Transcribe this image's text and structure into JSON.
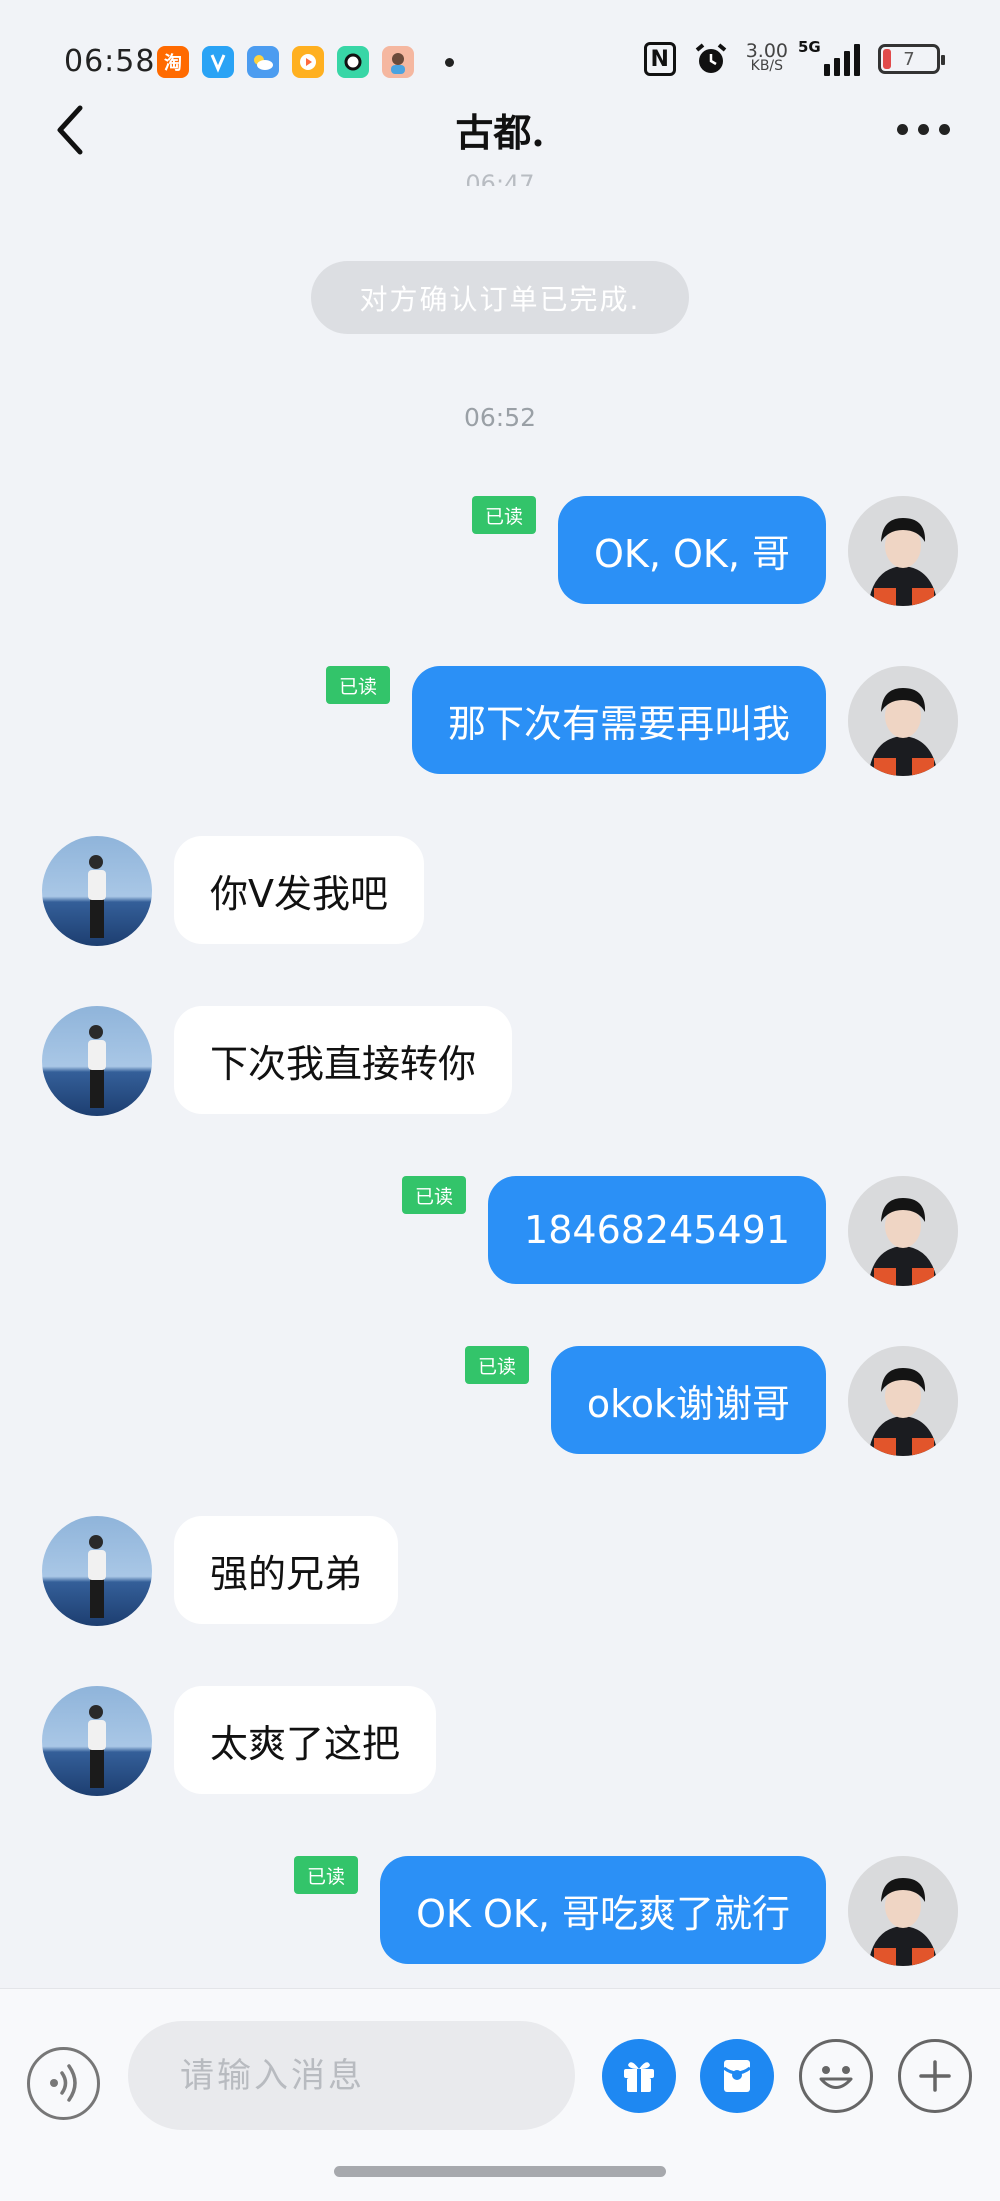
{
  "status_bar": {
    "time": "06:58",
    "app_icons": [
      {
        "name": "taobao-icon",
        "label": "淘",
        "color": "#ff6a00"
      },
      {
        "name": "app-blue-icon",
        "label": "",
        "color": "#2aa3f5"
      },
      {
        "name": "weather-icon",
        "label": "",
        "color": "#4c9cf0"
      },
      {
        "name": "video-app-icon",
        "label": "",
        "color": "#ffb020"
      },
      {
        "name": "camera-app-icon",
        "label": "",
        "color": "#38d6a6"
      },
      {
        "name": "avatar-app-icon",
        "label": "",
        "color": "#f5b7a0"
      }
    ],
    "net_speed_value": "3.00",
    "net_speed_unit": "KB/S",
    "network": "5G",
    "battery": "7"
  },
  "nav": {
    "title": "古都."
  },
  "chat": {
    "partial_time": "06:47",
    "system_notice": "对方确认订单已完成.",
    "timestamp": "06:52",
    "read_label": "已读",
    "messages": [
      {
        "from": "self",
        "text": "OK, OK, 哥",
        "read": true
      },
      {
        "from": "self",
        "text": "那下次有需要再叫我",
        "read": true
      },
      {
        "from": "peer",
        "text": "你V发我吧"
      },
      {
        "from": "peer",
        "text": "下次我直接转你"
      },
      {
        "from": "self",
        "text": "18468245491",
        "read": true
      },
      {
        "from": "self",
        "text": "okok谢谢哥",
        "read": true
      },
      {
        "from": "peer",
        "text": "强的兄弟"
      },
      {
        "from": "peer",
        "text": "太爽了这把"
      },
      {
        "from": "self",
        "text": "OK OK, 哥吃爽了就行",
        "read": true
      }
    ]
  },
  "input_bar": {
    "placeholder": "请输入消息",
    "value": ""
  },
  "colors": {
    "outgoing_bubble": "#2b90f6",
    "incoming_bubble": "#ffffff",
    "read_badge": "#33c46a",
    "background": "#f1f3f7"
  }
}
